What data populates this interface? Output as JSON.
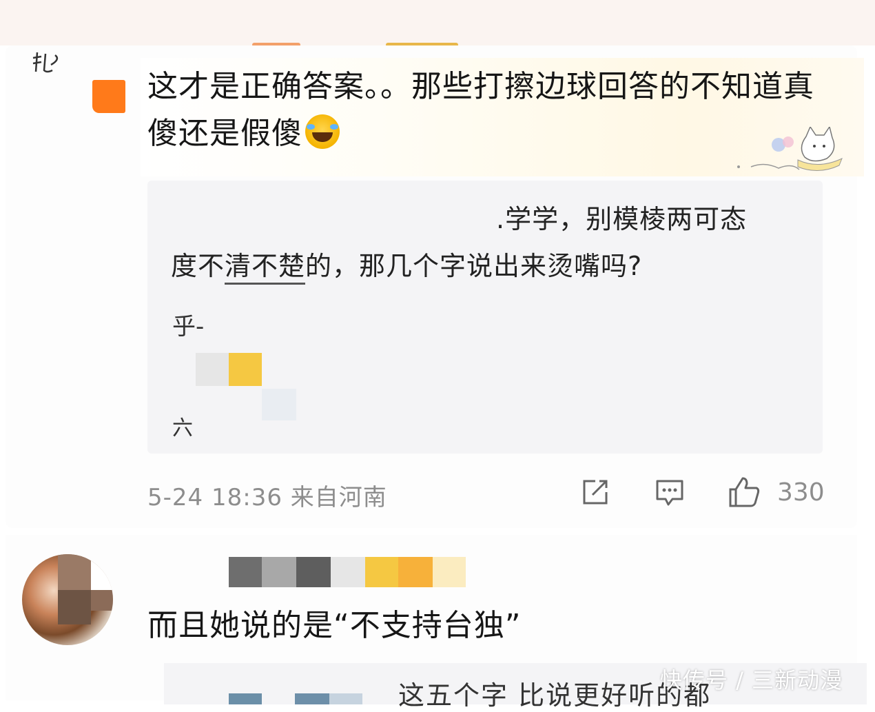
{
  "comment1": {
    "text": "这才是正确答案。。那些打擦边球回答的不知道真傻还是假傻",
    "emoji_icon": "laughing-crying-emoji",
    "badge_color": "#ff7a1a"
  },
  "quote1": {
    "line1": ".学学，别模棱两可态",
    "line2_a": "度不",
    "line2_b": "清不楚",
    "line2_c": "的，那几个字说出来烫嘴吗?",
    "fragment_top": "乎-",
    "fragment_bottom": "六"
  },
  "meta1": {
    "timestamp": "5-24 18:36",
    "location": "来自河南",
    "like_count": "330",
    "icons": [
      "share-icon",
      "comment-icon",
      "like-icon"
    ]
  },
  "comment2": {
    "text": "而且她说的是“不支持台独”"
  },
  "quote2": {
    "text": "这五个字 比说更好听的都"
  },
  "watermark": {
    "text": "快传号 / 三新动漫"
  },
  "colors": {
    "meta_gray": "#8d8d8d",
    "quote_bg": "#f4f4f6",
    "accent_yellow": "#f5c842"
  }
}
